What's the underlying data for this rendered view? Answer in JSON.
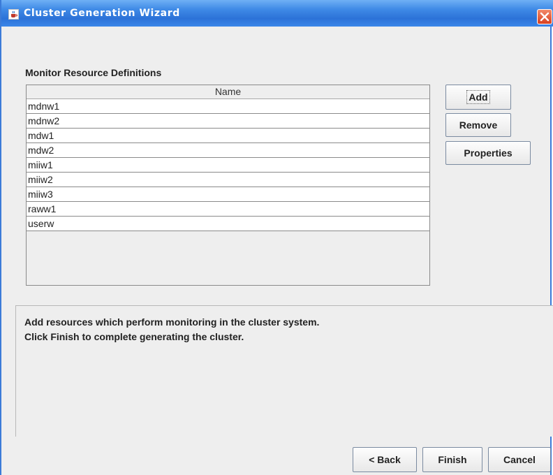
{
  "window": {
    "title": "Cluster Generation Wizard",
    "app_icon": "java-cup-icon",
    "close_icon": "close-icon"
  },
  "section": {
    "label": "Monitor Resource Definitions"
  },
  "table": {
    "column_header": "Name",
    "rows": [
      "mdnw1",
      "mdnw2",
      "mdw1",
      "mdw2",
      "miiw1",
      "miiw2",
      "miiw3",
      "raww1",
      "userw"
    ]
  },
  "side_buttons": {
    "add": "Add",
    "remove": "Remove",
    "properties": "Properties"
  },
  "description": {
    "line1": "Add resources which perform monitoring in the cluster system.",
    "line2": "Click Finish to complete generating the cluster."
  },
  "footer_buttons": {
    "back": "< Back",
    "finish": "Finish",
    "cancel": "Cancel"
  },
  "colors": {
    "titlebar": "#2c72d8",
    "window_bg": "#eeeeee",
    "close_button": "#d8401f"
  }
}
